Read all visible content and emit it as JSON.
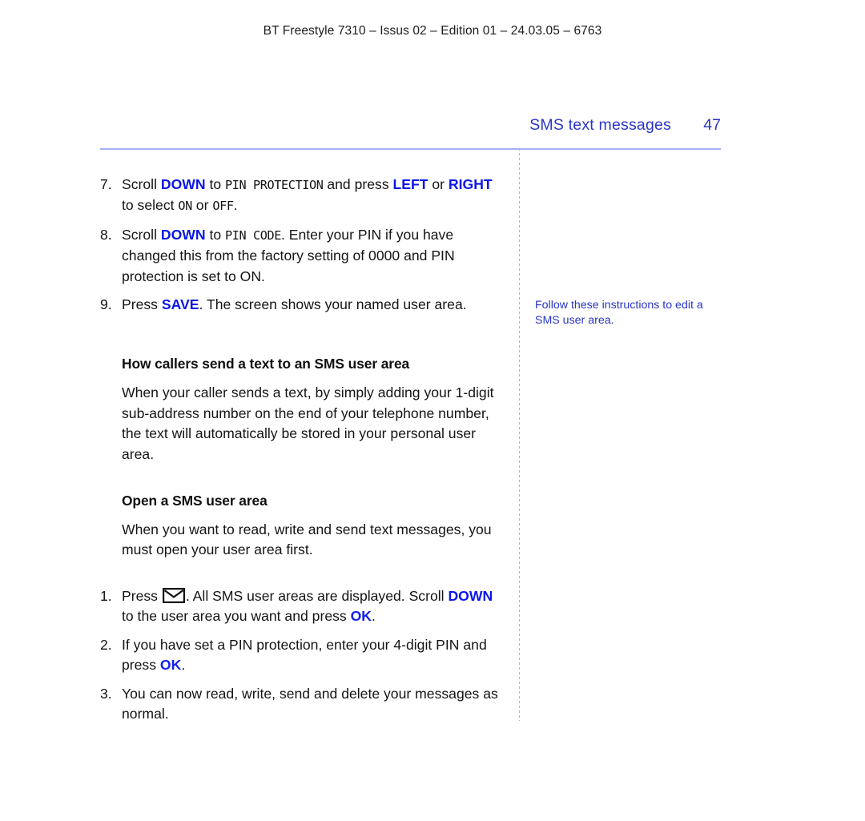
{
  "running_head": "BT Freestyle 7310 – Issus 02 – Edition 01 – 24.03.05 – 6763",
  "section": {
    "title": "SMS text messages",
    "page_number": "47"
  },
  "colors": {
    "rule": "#a7aef4",
    "section_title": "#2a35c8",
    "key_highlight": "#0b16e8",
    "side_note": "#2a35c8",
    "body_text": "#141414"
  },
  "steps_group_1": [
    {
      "number": "7.",
      "parts": [
        {
          "t": "Scroll ",
          "s": "plain"
        },
        {
          "t": "DOWN",
          "s": "key"
        },
        {
          "t": " to ",
          "s": "plain"
        },
        {
          "t": "PIN PROTECTION",
          "s": "lcd"
        },
        {
          "t": " and press ",
          "s": "plain"
        },
        {
          "t": "LEFT",
          "s": "key"
        },
        {
          "t": " or ",
          "s": "plain"
        },
        {
          "t": "RIGHT",
          "s": "key"
        },
        {
          "t": " to select ",
          "s": "plain"
        },
        {
          "t": "ON",
          "s": "lcd"
        },
        {
          "t": " or ",
          "s": "plain"
        },
        {
          "t": "OFF",
          "s": "lcd"
        },
        {
          "t": ".",
          "s": "plain"
        }
      ]
    },
    {
      "number": "8.",
      "parts": [
        {
          "t": "Scroll ",
          "s": "plain"
        },
        {
          "t": "DOWN",
          "s": "key"
        },
        {
          "t": " to ",
          "s": "plain"
        },
        {
          "t": "PIN CODE",
          "s": "lcd"
        },
        {
          "t": ". Enter your PIN if you have changed this from the factory setting of 0000 and PIN protection is set to ON.",
          "s": "plain"
        }
      ]
    },
    {
      "number": "9.",
      "parts": [
        {
          "t": "Press ",
          "s": "plain"
        },
        {
          "t": "SAVE",
          "s": "key"
        },
        {
          "t": ". The screen shows your named user area.",
          "s": "plain"
        }
      ]
    }
  ],
  "heading_1": "How callers send a text to an SMS user area",
  "paragraph_1": "When your caller sends a text, by simply adding your 1-digit sub-address number on the end of your telephone number, the text will automatically be stored in your personal user area.",
  "heading_2": "Open a SMS user area",
  "paragraph_2": "When you want to read, write and send text messages, you must open your user area first.",
  "steps_group_2": [
    {
      "number": "1.",
      "parts": [
        {
          "t": "Press ",
          "s": "plain"
        },
        {
          "t": "envelope-icon",
          "s": "icon"
        },
        {
          "t": ". All SMS user areas are displayed. Scroll ",
          "s": "plain"
        },
        {
          "t": "DOWN",
          "s": "key"
        },
        {
          "t": " to the user area you want and press ",
          "s": "plain"
        },
        {
          "t": "OK",
          "s": "key-light"
        },
        {
          "t": ".",
          "s": "plain"
        }
      ]
    },
    {
      "number": "2.",
      "parts": [
        {
          "t": "If you have set a PIN protection, enter your 4-digit PIN and press ",
          "s": "plain"
        },
        {
          "t": "OK",
          "s": "key-light"
        },
        {
          "t": ".",
          "s": "plain"
        }
      ]
    },
    {
      "number": "3.",
      "parts": [
        {
          "t": "You can now read, write, send and delete your messages as normal.",
          "s": "plain"
        }
      ]
    }
  ],
  "side_note": "Follow these instructions to edit a SMS user area."
}
